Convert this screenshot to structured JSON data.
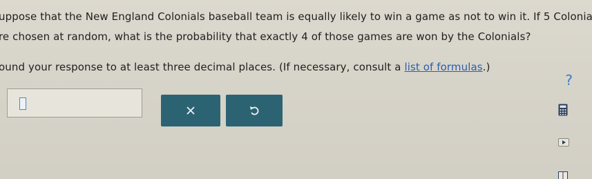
{
  "question": {
    "line1": "uppose that the New England Colonials baseball team is equally likely to win a game as not to win it. If 5 Colonials",
    "line2": "re chosen at random, what is the probability that exactly 4 of those games are won by the Colonials?",
    "line3_prefix": "ound your response to at least three decimal places. (If necessary, consult a ",
    "line3_link": "list of formulas",
    "line3_suffix": ".)"
  },
  "answer": {
    "value": ""
  },
  "buttons": {
    "clear_icon": "x-icon",
    "undo_icon": "undo-icon"
  },
  "side_tools": {
    "help_label": "?",
    "calculator_icon": "calculator-icon",
    "video_icon": "video-icon",
    "book_icon": "book-icon"
  },
  "colors": {
    "button_bg": "#2c6373",
    "link": "#2a5fa8",
    "help": "#3d7cc2",
    "page_bg": "#d7d4ca"
  }
}
